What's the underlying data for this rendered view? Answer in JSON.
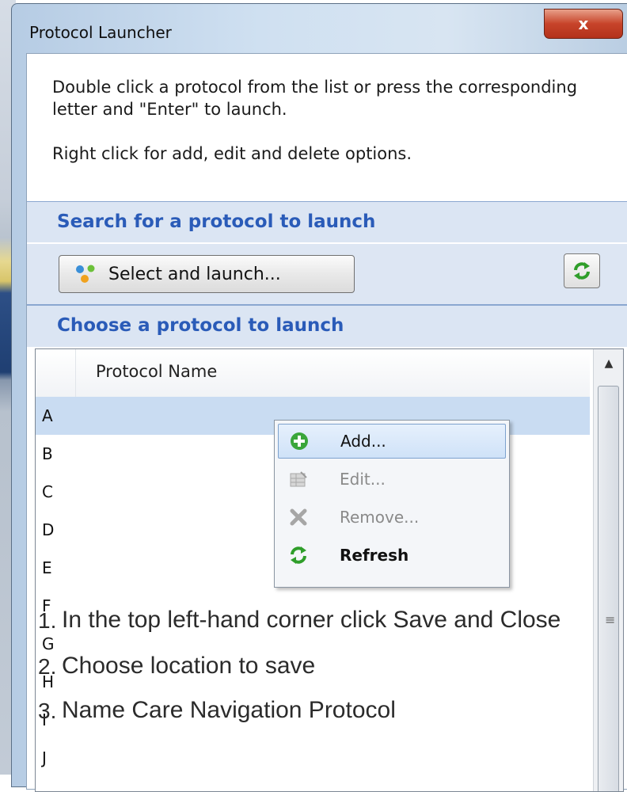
{
  "window": {
    "title": "Protocol Launcher",
    "close_glyph": "x"
  },
  "instructions": {
    "line1": "Double click a protocol from the list or press the corresponding letter and \"Enter\" to launch.",
    "line2": "Right click for add, edit and delete options."
  },
  "search_section": {
    "header": "Search for a protocol to launch",
    "button_label": "Select and launch..."
  },
  "choose_section": {
    "header": "Choose a protocol to launch",
    "column_header": "Protocol Name",
    "rows": [
      "A",
      "B",
      "C",
      "D",
      "E",
      "F",
      "G",
      "H",
      "I",
      "J"
    ],
    "selected_row": "A"
  },
  "context_menu": {
    "items": [
      {
        "label": "Add...",
        "icon": "add-icon",
        "enabled": true
      },
      {
        "label": "Edit...",
        "icon": "edit-icon",
        "enabled": false
      },
      {
        "label": "Remove...",
        "icon": "remove-icon",
        "enabled": false
      },
      {
        "label": "Refresh",
        "icon": "refresh-icon",
        "enabled": true
      }
    ]
  },
  "captions": [
    {
      "number": "1.",
      "text": "In the top left-hand corner click Save and Close"
    },
    {
      "number": "2.",
      "text": "Choose location to save"
    },
    {
      "number": "3.",
      "text": "Name Care Navigation Protocol"
    }
  ],
  "colors": {
    "section_text": "#2a5bb8",
    "section_bg": "#dbe5f3",
    "selection": "#c9dcf2",
    "close_button": "#c7442a",
    "refresh_green": "#2f9e2a"
  }
}
